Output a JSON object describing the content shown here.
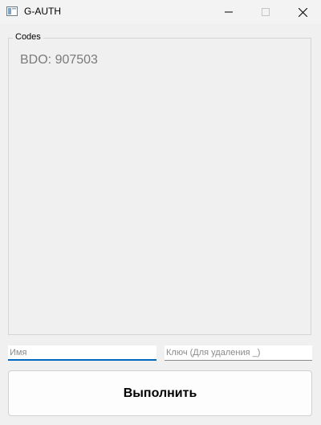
{
  "window": {
    "title": "G-AUTH",
    "controls": [
      "minimize-icon",
      "maximize-icon",
      "close-icon"
    ]
  },
  "codes_group": {
    "title": "Codes",
    "items": [
      {
        "label": "BDO: 907503"
      }
    ]
  },
  "inputs": {
    "name": {
      "value": "",
      "placeholder": "Имя"
    },
    "key": {
      "value": "",
      "placeholder": "Ключ (Для удаления _)"
    }
  },
  "actions": {
    "run_label": "Выполнить"
  },
  "colors": {
    "focus_accent": "#0067c0",
    "window_bg": "#f0f0f0"
  }
}
